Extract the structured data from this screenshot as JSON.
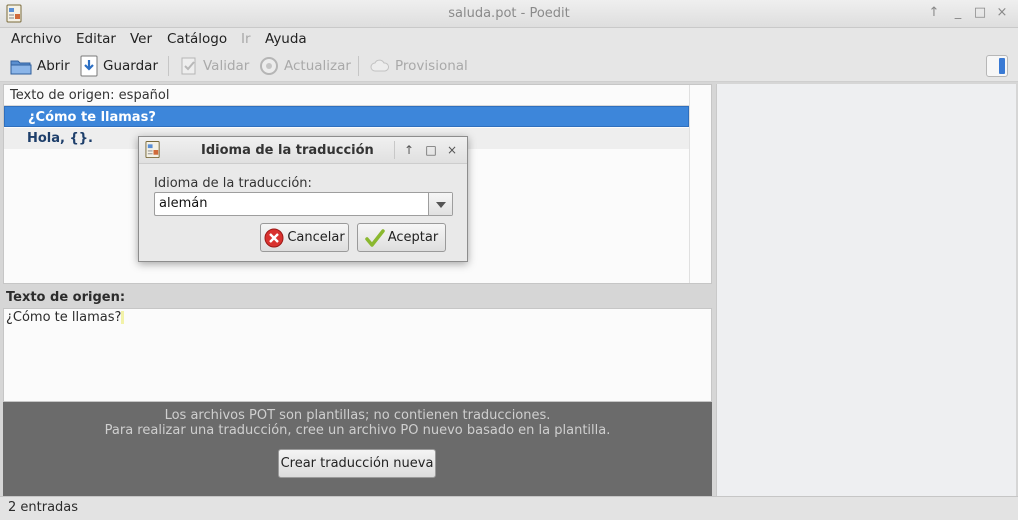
{
  "window": {
    "title": "saluda.pot - Poedit"
  },
  "menu": [
    {
      "label": "Archivo",
      "enabled": true
    },
    {
      "label": "Editar",
      "enabled": true
    },
    {
      "label": "Ver",
      "enabled": true
    },
    {
      "label": "Catálogo",
      "enabled": true
    },
    {
      "label": "Ir",
      "enabled": false
    },
    {
      "label": "Ayuda",
      "enabled": true
    }
  ],
  "toolbar": {
    "open": "Abrir",
    "save": "Guardar",
    "validate": "Validar",
    "update": "Actualizar",
    "fuzzy": "Provisional"
  },
  "list": {
    "header": "Texto de origen: español",
    "rows": [
      {
        "text": "¿Cómo te llamas?",
        "selected": true
      },
      {
        "text": "Hola, {}.",
        "selected": false
      }
    ]
  },
  "source": {
    "label": "Texto de origen:",
    "text": "¿Cómo te llamas?"
  },
  "notice": {
    "line1": "Los archivos POT son plantillas; no contienen traducciones.",
    "line2": "Para realizar una traducción, cree un archivo PO nuevo basado en la plantilla.",
    "button": "Crear traducción nueva"
  },
  "status": {
    "text": "2 entradas"
  },
  "dialog": {
    "title": "Idioma de la traducción",
    "label": "Idioma de la traducción:",
    "language_value": "alemán",
    "cancel": "Cancelar",
    "accept": "Aceptar"
  },
  "colors": {
    "selection": "#3d86da",
    "notice_bg": "#6b6b6b",
    "sidebar_bg": "#eeeff1"
  }
}
